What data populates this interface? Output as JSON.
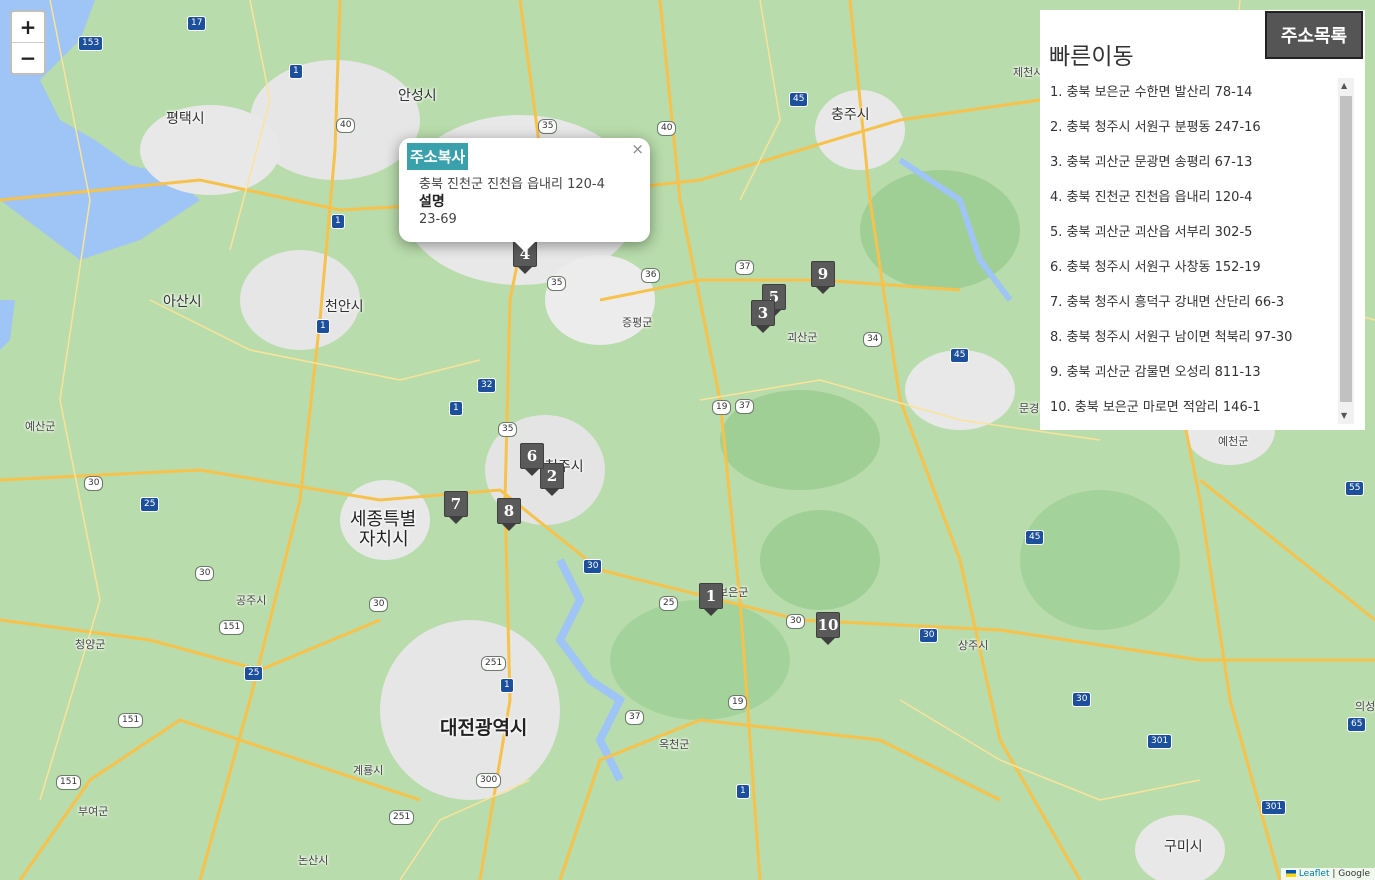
{
  "map": {
    "cities_big": [
      {
        "name": "대전광역시",
        "cls": "metro"
      },
      {
        "name": "세종특별",
        "cls": "big"
      },
      {
        "name": "자치시",
        "cls": "big"
      }
    ],
    "cities": [
      "평택시",
      "안성시",
      "충주시",
      "아산시",
      "천안시",
      "청주시",
      "괴산군",
      "증평군",
      "공주시",
      "청양군",
      "부여군",
      "논산시",
      "계룡시",
      "옥천군",
      "보은군",
      "상주시",
      "예산군",
      "구미시",
      "예천군",
      "제천시",
      "문경",
      "의성"
    ]
  },
  "zoom": {
    "in_label": "+",
    "out_label": "−"
  },
  "markers": [
    "1",
    "2",
    "3",
    "4",
    "5",
    "6",
    "7",
    "8",
    "9",
    "10"
  ],
  "popup": {
    "copy_label": "주소복사",
    "close": "×",
    "address": "충북 진천군 진천읍 읍내리 120-4",
    "desc_label": "설명",
    "desc_value": "23-69"
  },
  "panel": {
    "title": "빠른이동",
    "items": [
      "1. 충북 보은군 수한면 발산리 78-14",
      "2. 충북 청주시 서원구 분평동 247-16",
      "3. 충북 괴산군 문광면 송평리 67-13",
      "4. 충북 진천군 진천읍 읍내리 120-4",
      "5. 충북 괴산군 괴산읍 서부리 302-5",
      "6. 충북 청주시 서원구 사창동 152-19",
      "7. 충북 청주시 흥덕구 강내면 산단리 66-3",
      "8. 충북 청주시 서원구 남이면 척북리 97-30",
      "9. 충북 괴산군 감물면 오성리 811-13",
      "10. 충북 보은군 마로면 적암리 146-1"
    ]
  },
  "list_button": "주소목록",
  "attribution": {
    "leaflet": "Leaflet",
    "sep": " | ",
    "google": "Google"
  }
}
